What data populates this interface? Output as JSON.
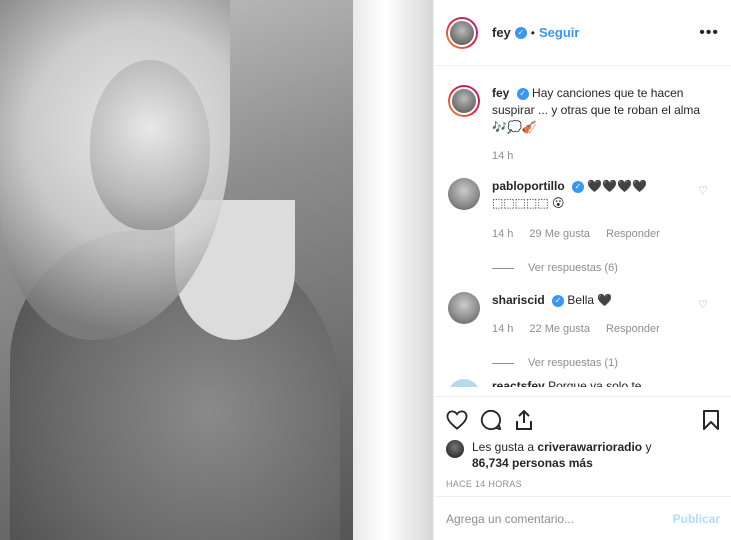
{
  "post": {
    "username": "fey",
    "follow_label": "Seguir",
    "dot": "•",
    "more_label": "•••"
  },
  "caption": {
    "username": "fey",
    "text": "Hay canciones que te hacen suspirar ... y otras que te roban el alma 🎶💭🎻",
    "time": "14 h"
  },
  "comments": [
    {
      "username": "pabloportillo",
      "text": "🖤🖤🖤🖤 ⬚⬚⬚⬚⬚ 😮",
      "time": "14 h",
      "likes": "29 Me gusta",
      "reply": "Responder",
      "view_replies": "Ver respuestas (6)"
    },
    {
      "username": "shariscid",
      "text": "Bella 🖤",
      "time": "14 h",
      "likes": "22 Me gusta",
      "reply": "Responder",
      "view_replies": "Ver respuestas (1)"
    },
    {
      "username": "reactsfey",
      "text": "Porque ya solo te"
    }
  ],
  "likes": {
    "prefix": "Les gusta a ",
    "user": "criverawarrioradio",
    "middle": " y",
    "count": "86,734 personas más"
  },
  "time_ago": "HACE 14 HORAS",
  "add_comment": {
    "placeholder": "Agrega un comentario...",
    "publish_label": "Publicar"
  },
  "colors": {
    "accent": "#3897f0",
    "publish_disabled": "#b3dbff",
    "muted": "#8e8e8e",
    "text": "#262626"
  }
}
